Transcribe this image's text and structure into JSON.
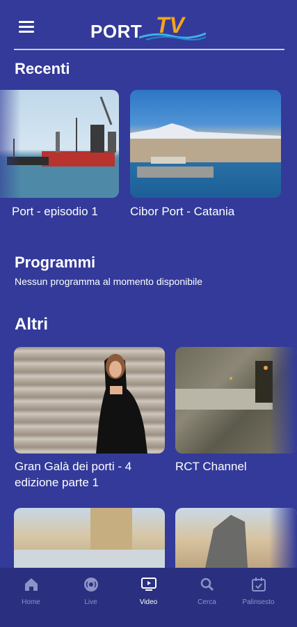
{
  "header": {
    "logo_port": "PORT",
    "logo_tv": "TV"
  },
  "sections": {
    "recenti": "Recenti",
    "programmi": "Programmi",
    "programmi_empty": "Nessun programma al momento disponibile",
    "altri": "Altri"
  },
  "recenti": [
    {
      "title": "Port - episodio 1"
    },
    {
      "title": "Cibor Port - Catania"
    }
  ],
  "altri": [
    {
      "title": "Gran Galà dei porti - 4 edizione parte 1"
    },
    {
      "title": "RCT Channel"
    }
  ],
  "nav": [
    {
      "label": "Home",
      "icon": "home-icon"
    },
    {
      "label": "Live",
      "icon": "live-icon"
    },
    {
      "label": "Video",
      "icon": "video-icon",
      "active": true
    },
    {
      "label": "Cerca",
      "icon": "search-icon"
    },
    {
      "label": "Palinsesto",
      "icon": "calendar-icon"
    }
  ],
  "colors": {
    "background": "#333a99",
    "nav_background": "#2a307f",
    "accent": "#f2a51a"
  }
}
